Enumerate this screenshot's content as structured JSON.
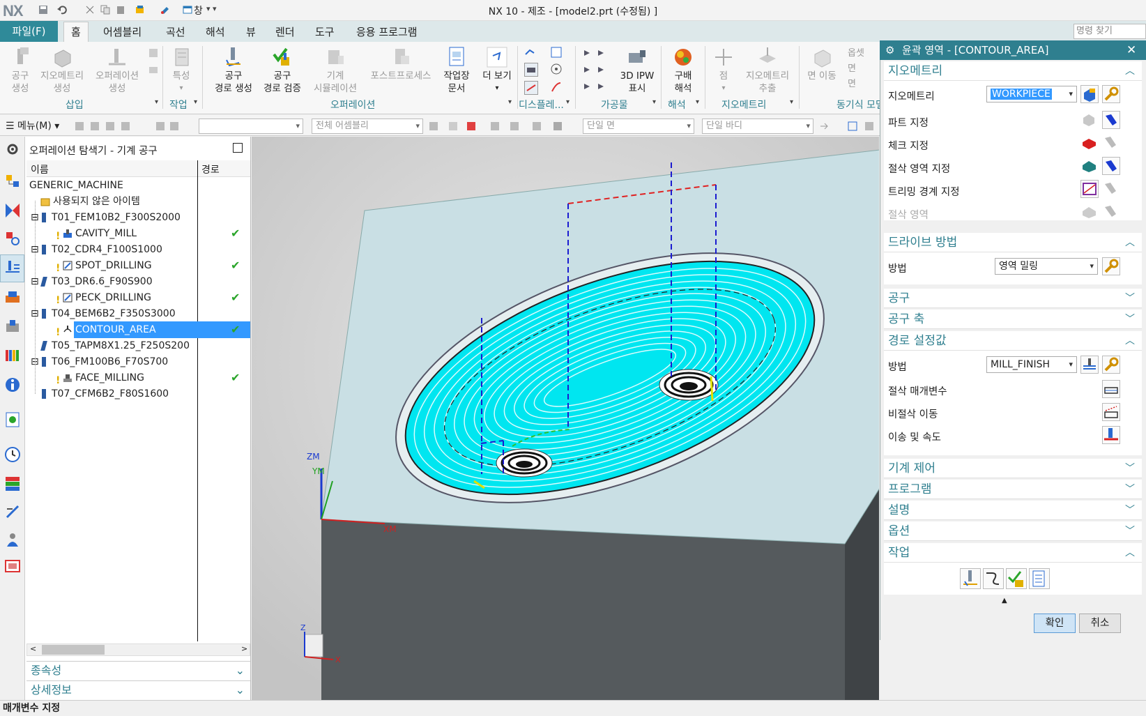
{
  "app": {
    "title": "NX 10 - 제조 - [model2.prt (수정됨) ]",
    "logo": "NX",
    "window_menu": "창",
    "command_finder_placeholder": "명령 찾기"
  },
  "tabs": [
    "파일(F)",
    "홈",
    "어셈블리",
    "곡선",
    "해석",
    "뷰",
    "렌더",
    "도구",
    "응용 프로그램"
  ],
  "ribbon": {
    "buttons": {
      "create_tool": [
        "공구",
        "생성"
      ],
      "create_geometry": [
        "지오메트리",
        "생성"
      ],
      "create_operation": [
        "오퍼레이션",
        "생성"
      ],
      "properties": "특성",
      "generate_toolpath": [
        "공구",
        "경로 생성"
      ],
      "verify_toolpath": [
        "공구",
        "경로 검증"
      ],
      "machine_simulation": [
        "기계",
        "시뮬레이션"
      ],
      "postprocess": "포스트프로세스",
      "shop_docs": [
        "작업장",
        "문서"
      ],
      "more_views": "더 보기",
      "show_3d_ipw": [
        "3D IPW",
        "표시"
      ],
      "draft_analysis": [
        "구배",
        "해석"
      ],
      "point": "점",
      "extract_geometry": [
        "지오메트리",
        "추출"
      ],
      "move_face": "면 이동",
      "sync_small": [
        "옵셋",
        "면",
        "면"
      ]
    },
    "groups": [
      "삽입",
      "작업",
      "오퍼레이션",
      "디스플레...",
      "가공물",
      "해석",
      "지오메트리",
      "동기식 모델링"
    ]
  },
  "selection_bar": {
    "menu": "메뉴(M)",
    "filter_placeholder": "",
    "assembly_scope": "전체 어셈블리",
    "face_rule": "단일 면",
    "body_rule": "단일 바디"
  },
  "navigator": {
    "title": "오퍼레이션 탐색기 - 기계 공구",
    "col_name": "이름",
    "col_path": "경로",
    "rows": [
      {
        "label": "GENERIC_MACHINE",
        "check": ""
      },
      {
        "label": "사용되지 않은 아이템",
        "check": ""
      },
      {
        "label": "T01_FEM10B2_F300S2000",
        "check": ""
      },
      {
        "label": "CAVITY_MILL",
        "check": "✔"
      },
      {
        "label": "T02_CDR4_F100S1000",
        "check": ""
      },
      {
        "label": "SPOT_DRILLING",
        "check": "✔"
      },
      {
        "label": "T03_DR6.6_F90S900",
        "check": ""
      },
      {
        "label": "PECK_DRILLING",
        "check": "✔"
      },
      {
        "label": "T04_BEM6B2_F350S3000",
        "check": ""
      },
      {
        "label": "CONTOUR_AREA",
        "check": "✔"
      },
      {
        "label": "T05_TAPM8X1.25_F250S200",
        "check": ""
      },
      {
        "label": "T06_FM100B6_F70S700",
        "check": ""
      },
      {
        "label": "FACE_MILLING",
        "check": "✔"
      },
      {
        "label": "T07_CFM6B2_F80S1600",
        "check": ""
      }
    ],
    "dependencies": "종속성",
    "details": "상세정보"
  },
  "viewport": {
    "axis_zm": "ZM",
    "axis_ym": "YM",
    "axis_xm": "XM",
    "triad_z": "Z",
    "triad_x": "X"
  },
  "dialog": {
    "title": "윤곽 영역 - [CONTOUR_AREA]",
    "geometry_section": "지오메트리",
    "geometry_label": "지오메트리",
    "geometry_value": "WORKPIECE",
    "specify_part": "파트 지정",
    "specify_check": "체크 지정",
    "specify_cut_area": "절삭 영역 지정",
    "specify_trim": "트리밍 경계 지정",
    "cut_area": "절삭 영역",
    "drive_section": "드라이브 방법",
    "drive_method_label": "방법",
    "drive_method_value": "영역 밀링",
    "tool_section": "공구",
    "tool_axis_section": "공구 축",
    "path_settings_section": "경로 설정값",
    "path_method_label": "방법",
    "path_method_value": "MILL_FINISH",
    "cut_params": "절삭 매개변수",
    "non_cut_moves": "비절삭 이동",
    "feeds_speeds": "이송 및 속도",
    "machine_control_section": "기계 제어",
    "program_section": "프로그램",
    "description_section": "설명",
    "options_section": "옵션",
    "actions_section": "작업",
    "ok": "확인",
    "cancel": "취소"
  },
  "status": "매개변수 지정",
  "colors": {
    "accent": "#2f7f8f",
    "file_tab": "#2f8a99",
    "selection": "#3399ff",
    "toolpath": "#00e6f0",
    "part_top": "#c9dfe4",
    "part_side": "#555a5d"
  }
}
